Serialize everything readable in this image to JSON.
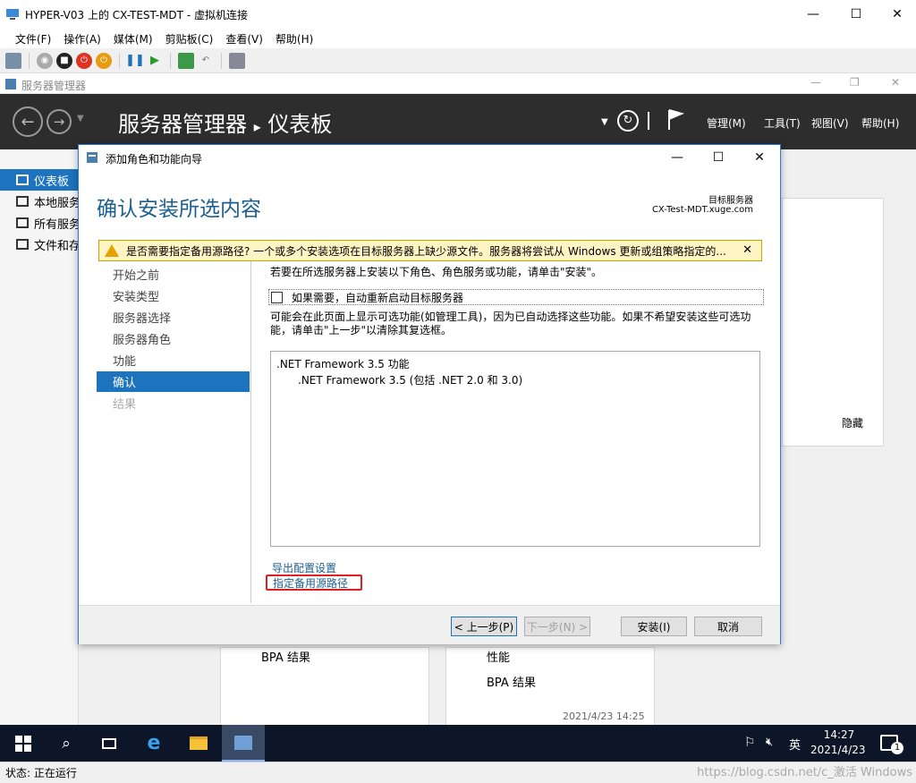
{
  "vm": {
    "title": "HYPER-V03 上的 CX-TEST-MDT - 虚拟机连接",
    "menu": [
      "文件(F)",
      "操作(A)",
      "媒体(M)",
      "剪贴板(C)",
      "查看(V)",
      "帮助(H)"
    ],
    "status": "状态: 正在运行"
  },
  "sm": {
    "window_title": "服务器管理器",
    "heading": "服务器管理器",
    "breadcrumb_sep": "▸",
    "page": "仪表板",
    "menu": [
      "管理(M)",
      "工具(T)",
      "视图(V)",
      "帮助(H)"
    ],
    "sidebar": [
      "仪表板",
      "本地服务器",
      "所有服务器",
      "文件和存储服务"
    ],
    "tiles": {
      "hide": "隐藏",
      "bpa1": "BPA 结果",
      "perf": "性能",
      "bpa2": "BPA 结果",
      "timestamp": "2021/4/23 14:25"
    }
  },
  "dialog": {
    "title": "添加角色和功能向导",
    "heading": "确认安装所选内容",
    "server_label": "目标服务器",
    "server_name": "CX-Test-MDT.xuge.com",
    "warning": "是否需要指定备用源路径? 一个或多个安装选项在目标服务器上缺少源文件。服务器将尝试从 Windows 更新或组策略指定的...",
    "steps": [
      "开始之前",
      "安装类型",
      "服务器选择",
      "服务器角色",
      "功能",
      "确认",
      "结果"
    ],
    "active_step": 5,
    "desc1": "若要在所选服务器上安装以下角色、角色服务或功能，请单击\"安装\"。",
    "restart_label": "如果需要，自动重新启动目标服务器",
    "desc2": "可能会在此页面上显示可选功能(如管理工具)，因为已自动选择这些功能。如果不希望安装这些可选功能，请单击\"上一步\"以清除其复选框。",
    "features": [
      ".NET Framework 3.5 功能",
      ".NET Framework 3.5 (包括 .NET 2.0 和 3.0)"
    ],
    "export_link": "导出配置设置",
    "alt_source_link": "指定备用源路径",
    "buttons": {
      "prev": "< 上一步(P)",
      "next": "下一步(N) >",
      "install": "安装(I)",
      "cancel": "取消"
    }
  },
  "taskbar": {
    "lang": "英",
    "time": "14:27",
    "date": "2021/4/23",
    "notif_count": "1"
  },
  "watermark": "https://blog.csdn.net/c_激活 Windows"
}
